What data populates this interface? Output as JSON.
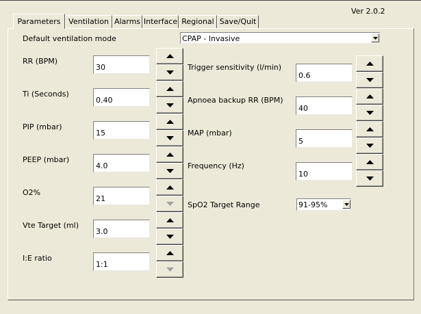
{
  "version": "Ver 2.0.2",
  "tabs": [
    {
      "label": "Parameters",
      "active": true
    },
    {
      "label": "Ventilation",
      "active": false
    },
    {
      "label": "Alarms",
      "active": false
    },
    {
      "label": "Interface",
      "active": false
    },
    {
      "label": "Regional",
      "active": false
    },
    {
      "label": "Save/Quit",
      "active": false
    }
  ],
  "mode": {
    "label": "Default ventilation mode",
    "value": "CPAP - Invasive"
  },
  "left_params": [
    {
      "label": "RR (BPM)",
      "value": "30",
      "up_enabled": true,
      "down_enabled": true
    },
    {
      "label": "Ti (Seconds)",
      "value": "0.40",
      "up_enabled": true,
      "down_enabled": true
    },
    {
      "label": "PIP (mbar)",
      "value": "15",
      "up_enabled": true,
      "down_enabled": true
    },
    {
      "label": "PEEP (mbar)",
      "value": "4.0",
      "up_enabled": true,
      "down_enabled": true
    },
    {
      "label": "O2%",
      "value": "21",
      "up_enabled": true,
      "down_enabled": false
    },
    {
      "label": "Vte Target (ml)",
      "value": "3.0",
      "up_enabled": true,
      "down_enabled": true
    },
    {
      "label": "I:E ratio",
      "value": "1:1",
      "up_enabled": true,
      "down_enabled": false
    }
  ],
  "right_params": [
    {
      "label": "Trigger sensitivity (l/min)",
      "value": "0.6",
      "up_enabled": true,
      "down_enabled": true
    },
    {
      "label": "Apnoea backup RR (BPM)",
      "value": "40",
      "up_enabled": true,
      "down_enabled": true
    },
    {
      "label": "MAP (mbar)",
      "value": "5",
      "up_enabled": true,
      "down_enabled": true
    },
    {
      "label": "Frequency (Hz)",
      "value": "10",
      "up_enabled": true,
      "down_enabled": true
    }
  ],
  "spo2": {
    "label": "SpO2 Target Range",
    "value": "91-95%"
  },
  "colors": {
    "enabled_arrow": "#000000",
    "disabled_arrow": "#a0a0a0",
    "background": "#ece9d8"
  },
  "icons": {
    "up": "triangle-up-icon",
    "down": "triangle-down-icon",
    "dropdown": "dropdown-arrow-icon"
  }
}
